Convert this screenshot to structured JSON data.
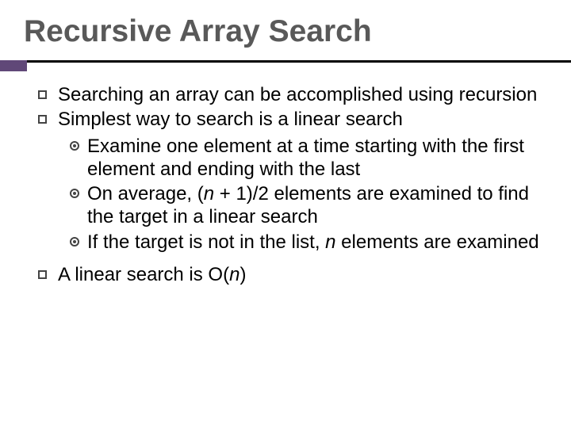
{
  "title": "Recursive Array Search",
  "bullets": {
    "b1": "Searching an array can be accomplished using recursion",
    "b2": "Simplest way to search is a linear search",
    "sub1_a": "Examine one element at a time starting with the first element and ending with the last",
    "sub2_a": "On average, (",
    "sub2_n": "n",
    "sub2_b": " + 1)/2 elements are examined to find the target in a linear search",
    "sub3_a": "If the target is not in the list, ",
    "sub3_n": "n",
    "sub3_b": " elements are examined",
    "b3_a": "A linear search is O(",
    "b3_n": "n",
    "b3_b": ")"
  }
}
